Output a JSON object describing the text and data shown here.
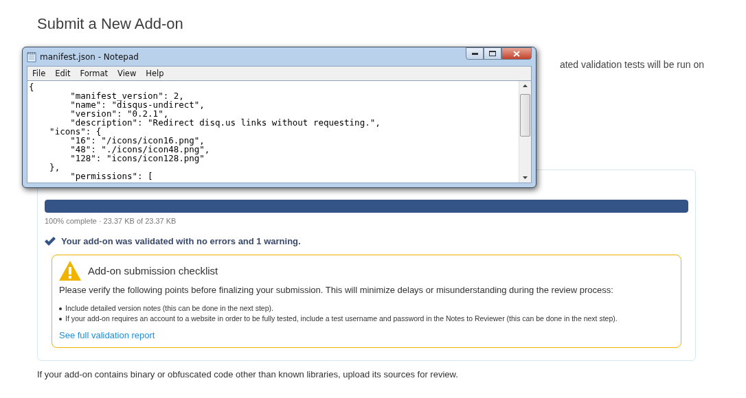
{
  "page": {
    "title": "Submit a New Add-on",
    "intro_fragment": "ated validation tests will be run on"
  },
  "upload": {
    "level": 1,
    "progress_text": "100% complete · 23.37 KB of 23.37 KB",
    "result": "Your add-on was validated with no errors and 1 warning."
  },
  "checklist": {
    "title": "Add-on submission checklist",
    "intro": "Please verify the following points before finalizing your submission. This will minimize delays or misunderstanding during the review process:",
    "items": [
      "Include detailed version notes (this can be done in the next step).",
      "If your add-on requires an account to a website in order to be fully tested, include a test username and password in the Notes to Reviewer (this can be done in the next step)."
    ],
    "link": "See full validation report"
  },
  "footer_text": "If your add-on contains binary or obfuscated code other than known libraries, upload its sources for review.",
  "notepad": {
    "title": "manifest.json - Notepad",
    "menu": [
      "File",
      "Edit",
      "Format",
      "View",
      "Help"
    ],
    "lines": [
      "{",
      "        \"manifest_version\": 2,",
      "        \"name\": \"disqus-undirect\",",
      "        \"version\": \"0.2.1\",",
      "        \"description\": \"Redirect disq.us links without requesting.\",",
      "    \"icons\": {",
      "        \"16\": \"/icons/icon16.png\",",
      "        \"48\": \"./icons/icon48.png\",",
      "        \"128\": \"icons/icon128.png\"",
      "    },",
      "        \"permissions\": ["
    ]
  }
}
